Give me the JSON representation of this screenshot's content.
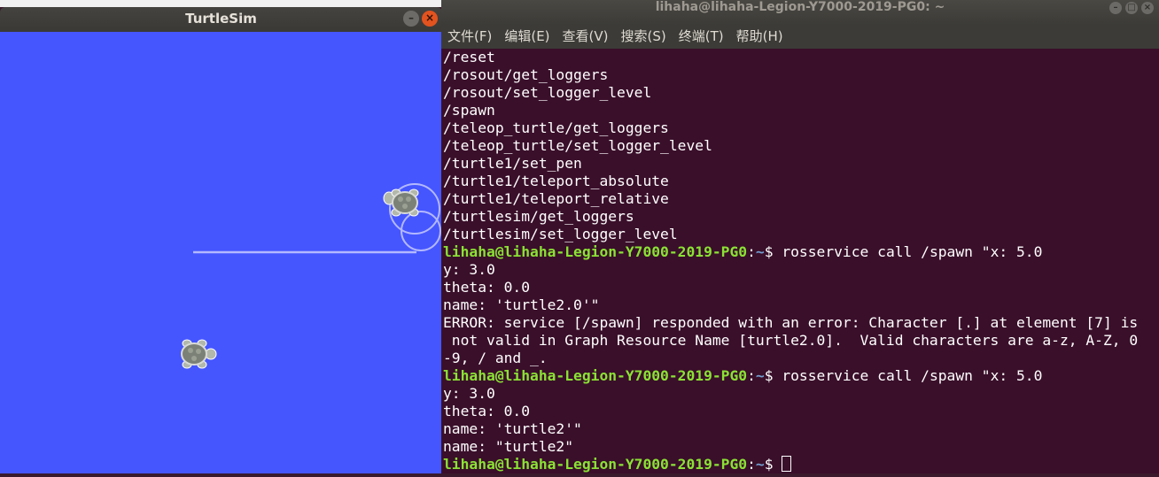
{
  "turtlesim": {
    "title": "TurtleSim",
    "minimize_glyph": "–",
    "close_glyph": "×",
    "background_color": "#4556ff",
    "icons": [
      "minimize-icon",
      "close-icon",
      "turtle-icon"
    ]
  },
  "terminal": {
    "title": "lihaha@lihaha-Legion-Y7000-2019-PG0: ~",
    "window_buttons": [
      "–",
      "□",
      "×"
    ],
    "menu": [
      "文件(F)",
      "编辑(E)",
      "查看(V)",
      "搜索(S)",
      "终端(T)",
      "帮助(H)"
    ],
    "prompt_user": "lihaha@lihaha-Legion-Y7000-2019-PG0",
    "prompt_path": "~",
    "prompt_symbol": "$ ",
    "lines": {
      "l0": "/reset",
      "l1": "/rosout/get_loggers",
      "l2": "/rosout/set_logger_level",
      "l3": "/spawn",
      "l4": "/teleop_turtle/get_loggers",
      "l5": "/teleop_turtle/set_logger_level",
      "l6": "/turtle1/set_pen",
      "l7": "/turtle1/teleport_absolute",
      "l8": "/turtle1/teleport_relative",
      "l9": "/turtlesim/get_loggers",
      "l10": "/turtlesim/set_logger_level",
      "cmd1": "rosservice call /spawn \"x: 5.0",
      "l12": "y: 3.0",
      "l13": "theta: 0.0",
      "l14": "name: 'turtle2.0'\"",
      "l15": "ERROR: service [/spawn] responded with an error: Character [.] at element [7] is",
      "l16": " not valid in Graph Resource Name [turtle2.0].  Valid characters are a-z, A-Z, 0",
      "l17": "-9, / and _.",
      "cmd2": "rosservice call /spawn \"x: 5.0",
      "l19": "y: 3.0",
      "l20": "theta: 0.0",
      "l21": "name: 'turtle2'\"",
      "l22": "name: \"turtle2\""
    },
    "colors": {
      "background": "#3a0f2a",
      "prompt_user": "#8ae234",
      "prompt_path": "#729fcf",
      "text": "#ffffff"
    }
  }
}
